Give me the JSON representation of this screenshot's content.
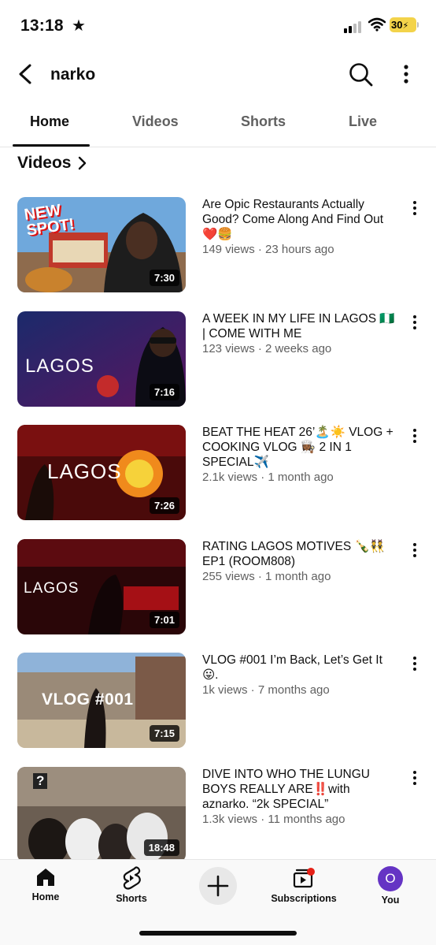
{
  "status_bar": {
    "time": "13:18",
    "star": "★",
    "battery": "30"
  },
  "header": {
    "channel_name": "narko"
  },
  "tabs": [
    {
      "label": "Home",
      "active": true
    },
    {
      "label": "Videos",
      "active": false
    },
    {
      "label": "Shorts",
      "active": false
    },
    {
      "label": "Live",
      "active": false
    }
  ],
  "section": {
    "title": "Videos"
  },
  "videos": [
    {
      "title": "Are Opic Restaurants Actually Good? Come Along And Find Out❤️🍔",
      "stats": "149 views · 23 hours ago",
      "duration": "7:30",
      "thumb_text": "NEW SPOT!"
    },
    {
      "title": "A WEEK IN MY LIFE IN LAGOS 🇳🇬 | COME WITH ME",
      "stats": "123 views · 2 weeks ago",
      "duration": "7:16",
      "thumb_text": "LAGOS"
    },
    {
      "title": "BEAT THE HEAT 26’🏝️☀️ VLOG + COOKING VLOG 👩🏾‍🍳 2 IN 1 SPECIAL✈️",
      "stats": "2.1k views · 1 month ago",
      "duration": "7:26",
      "thumb_text": "LAGOS"
    },
    {
      "title": "RATING LAGOS MOTIVES 🍾👯 EP1 (ROOM808)",
      "stats": "255 views · 1 month ago",
      "duration": "7:01",
      "thumb_text": "LAGOS"
    },
    {
      "title": "VLOG #001 I’m Back, Let’s Get It😛.",
      "stats": "1k views · 7 months ago",
      "duration": "7:15",
      "thumb_text": "VLOG #001"
    },
    {
      "title": "DIVE INTO WHO THE LUNGU BOYS REALLY ARE‼️with aznarko. “2k SPECIAL”",
      "stats": "1.3k views · 11 months ago",
      "duration": "18:48",
      "thumb_text": "?"
    }
  ],
  "bottom_nav": {
    "home": "Home",
    "shorts": "Shorts",
    "subscriptions": "Subscriptions",
    "you": "You",
    "avatar_letter": "O"
  },
  "colors": {
    "accent": "#0f0f0f",
    "muted": "#606060",
    "avatar": "#6534c4",
    "battery": "#f3d34a"
  }
}
